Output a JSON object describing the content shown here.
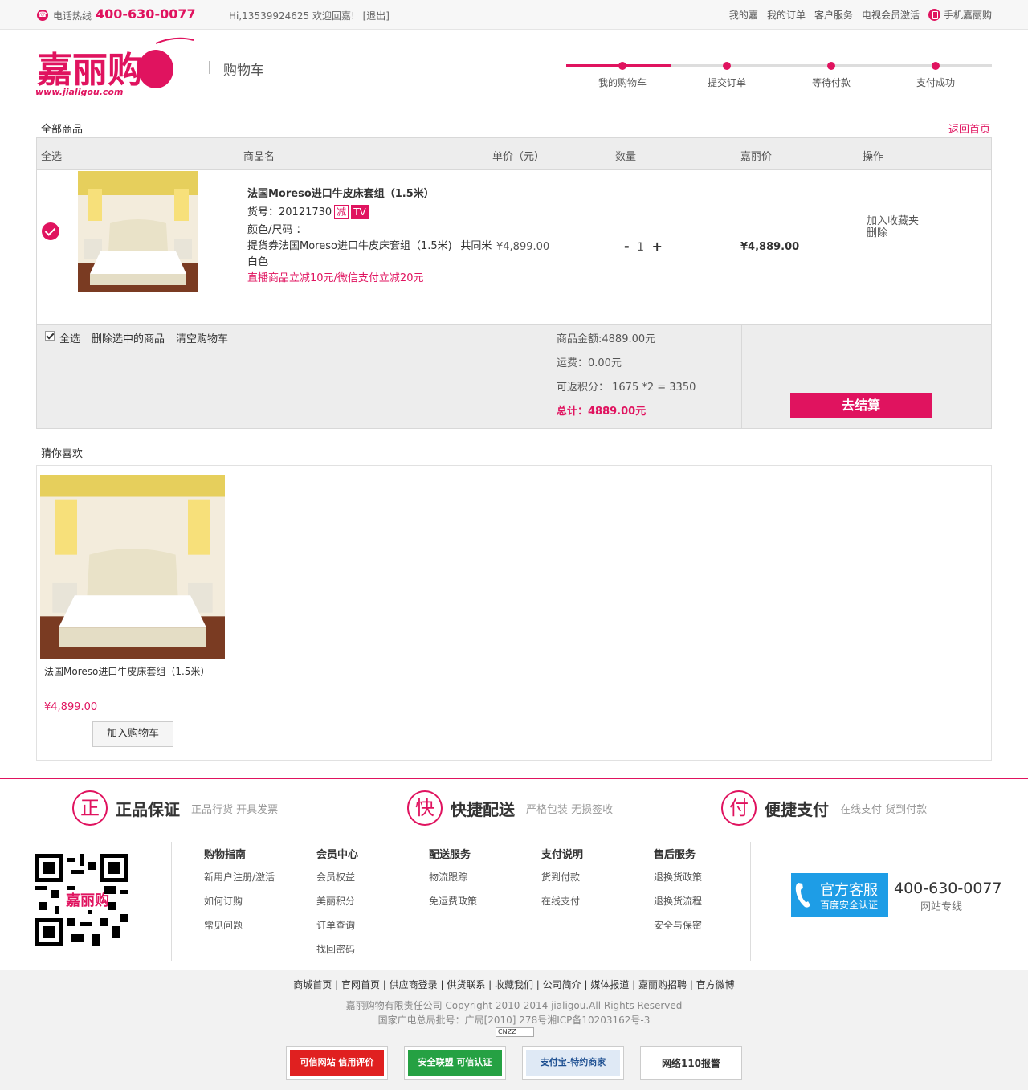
{
  "topbar": {
    "hotline_label": "电话热线",
    "hotline_number": "400-630-0077",
    "welcome": "Hi,13539924625 欢迎回嘉!",
    "logout": "[退出]",
    "links": [
      "我的嘉",
      "我的订单",
      "客户服务",
      "电视会员激活"
    ],
    "mobile": "手机嘉丽购"
  },
  "header": {
    "logo_text": "嘉丽购",
    "logo_url": "www.jialigou.com",
    "page_name": "购物车",
    "steps": [
      "我的购物车",
      "提交订单",
      "等待付款",
      "支付成功"
    ]
  },
  "cart": {
    "all_goods": "全部商品",
    "back_home": "返回首页",
    "columns": [
      "全选",
      "商品名",
      "单价（元）",
      "数量",
      "嘉丽价",
      "操作"
    ],
    "item": {
      "name": "法国Moreso进口牛皮床套组（1.5米）",
      "sku_label": "货号：20121730",
      "tag_reduce": "减",
      "tag_tv": "TV",
      "color_size": "颜色/尺码 ：",
      "desc": "提货券法国Moreso进口牛皮床套组（1.5米)_ 共同米",
      "color": "白色",
      "promo": "直播商品立减10元/微信支付立减20元",
      "unit_price": "¥4,899.00",
      "qty_minus": "-",
      "qty": "1",
      "qty_plus": "+",
      "jl_price": "¥4,889.00",
      "op_fav": "加入收藏夹",
      "op_delete": "删除"
    },
    "summary": {
      "select_all": "全选",
      "delete_selected": "删除选中的商品",
      "clear_cart": "清空购物车",
      "goods_amount": "商品金额:4889.00元",
      "shipping": "运费：0.00元",
      "points": "可返积分： 1675 *2 = 3350",
      "total": "总计：4889.00元",
      "checkout": "去结算"
    }
  },
  "recommend": {
    "title": "猜你喜欢",
    "name": "法国Moreso进口牛皮床套组（1.5米）",
    "price": "¥4,899.00",
    "add_button": "加入购物车"
  },
  "guarantees": [
    {
      "icon": "正",
      "title": "正品保证",
      "sub": "正品行货 开具发票"
    },
    {
      "icon": "快",
      "title": "快捷配送",
      "sub": "严格包装 无损签收"
    },
    {
      "icon": "付",
      "title": "便捷支付",
      "sub": "在线支付 货到付款"
    }
  ],
  "footer_cols": [
    {
      "title": "购物指南",
      "items": [
        "新用户注册/激活",
        "如何订购",
        "常见问题"
      ]
    },
    {
      "title": "会员中心",
      "items": [
        "会员权益",
        "美丽积分",
        "订单查询",
        "找回密码"
      ]
    },
    {
      "title": "配送服务",
      "items": [
        "物流跟踪",
        "免运费政策"
      ]
    },
    {
      "title": "支付说明",
      "items": [
        "货到付款",
        "在线支付"
      ]
    },
    {
      "title": "售后服务",
      "items": [
        "退换货政策",
        "退换货流程",
        "安全与保密"
      ]
    }
  ],
  "customer_service": {
    "title": "官方客服",
    "sub": "百度安全认证",
    "number": "400-630-0077",
    "label": "网站专线"
  },
  "bottom": {
    "links": "商城首页 | 官网首页 | 供应商登录 | 供货联系 | 收藏我们 | 公司简介 | 媒体报道 | 嘉丽购招聘 | 官方微博",
    "copyright": "嘉丽购物有限责任公司 Copyright 2010-2014 jialigou.All Rights Reserved",
    "icp": "国家广电总局批号：广局[2010] 278号湘ICP备10203162号-3",
    "cnzz": "CNZZ",
    "badges": [
      "可信网站 信用评价",
      "安全联盟 可信认证",
      "支付宝-特约商家",
      "网络110报警"
    ]
  },
  "colors": {
    "brand": "#e0135f",
    "service_blue": "#1e9de6"
  }
}
